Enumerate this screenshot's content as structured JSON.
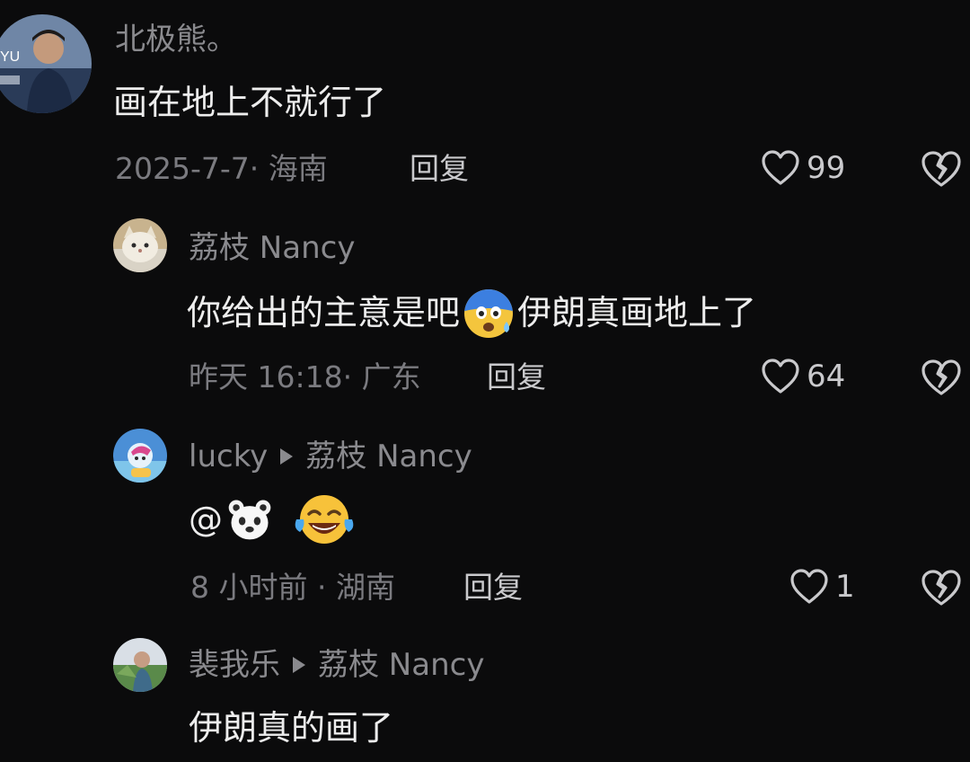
{
  "comments": [
    {
      "username": "北极熊。",
      "text": "画在地上不就行了",
      "date": "2025-7-7",
      "location": "海南",
      "reply_label": "回复",
      "likes": "99",
      "avatar_icon": "user-photo-avatar"
    },
    {
      "username": "荔枝 Nancy",
      "text_before": "你给出的主意是吧",
      "text_emoji": "shocked-blue-face-emoji",
      "text_after": "伊朗真画地上了",
      "date": "昨天 16:18",
      "location": "广东",
      "reply_label": "回复",
      "likes": "64",
      "avatar_icon": "cat-avatar"
    },
    {
      "username": "lucky",
      "reply_to": "荔枝 Nancy",
      "text_prefix": "@",
      "text_emoji_1": "bear-face-emoji",
      "text_emoji_2": "laughing-tears-emoji",
      "date": "8 小时前",
      "location": "湖南",
      "reply_label": "回复",
      "likes": "1",
      "avatar_icon": "cartoon-avatar"
    },
    {
      "username": "裴我乐",
      "reply_to": "荔枝 Nancy",
      "text": "伊朗真的画了",
      "avatar_icon": "outdoor-photo-avatar"
    }
  ],
  "separator": "·",
  "colors": {
    "background": "#0b0b0c",
    "primary_text": "#ededed",
    "secondary_text": "#8a8a8e"
  }
}
